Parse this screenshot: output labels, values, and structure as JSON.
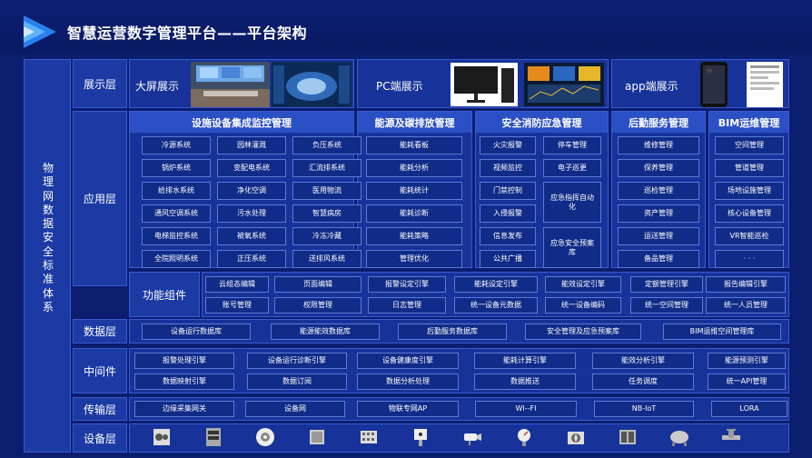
{
  "title": "智慧运营数字管理平台——平台架构",
  "sidebar": "物理网数据安全标准体系",
  "layers": {
    "display": "展示层",
    "app": "应用层",
    "func": "功能组件",
    "data": "数据层",
    "mid": "中间件",
    "trans": "传输层",
    "device": "设备层"
  },
  "display": {
    "big": "大屏展示",
    "pc": "PC端展示",
    "app": "app端展示"
  },
  "heads": [
    "设施设备集成监控管理",
    "能源及碳排放管理",
    "安全消防应急管理",
    "后勤服务管理",
    "BIM运维管理"
  ],
  "facility": [
    "冷源系统",
    "园林灌溉",
    "负压系统",
    "锅炉系统",
    "变配电系统",
    "汇流排系统",
    "给排水系统",
    "净化空调",
    "医用物流",
    "通风空调系统",
    "污水处理",
    "智慧病房",
    "电梯监控系统",
    "被氧系统",
    "冷冻冷藏",
    "全院照明系统",
    "正压系统",
    "送排风系统"
  ],
  "energy": [
    "能耗看板",
    "能耗分析",
    "能耗统计",
    "能耗诊断",
    "能耗策略",
    "管理优化"
  ],
  "safety": [
    "火灾报警",
    "停车管理",
    "视频监控",
    "电子巡更",
    "门禁控制",
    "入侵报警",
    "信息发布",
    "公共广播"
  ],
  "safety_big": [
    "应急指挥自动化",
    "应急安全预案库"
  ],
  "logistics": [
    "维修管理",
    "保养管理",
    "巡检管理",
    "资产管理",
    "运送管理",
    "备品管理"
  ],
  "bim": [
    "空间管理",
    "管道管理",
    "场地设施管理",
    "核心设备管理",
    "VR智能巡检",
    "· · ·"
  ],
  "func": [
    "云组态编辑",
    "页面编辑",
    "报警设定引擎",
    "能耗设定引擎",
    "能效设定引擎",
    "定额管理引擎",
    "报告编辑引擎",
    "账号管理",
    "权限管理",
    "日志管理",
    "统一设备元数据",
    "统一设备编码",
    "统一空间管理",
    "统一人员管理"
  ],
  "data": [
    "设备运行数据库",
    "能源能效数据库",
    "后勤服务数据库",
    "安全管理及应急预案库",
    "BIM运维空间管理库"
  ],
  "mid": [
    "报警处理引擎",
    "设备运行诊断引擎",
    "设备健康度引擎",
    "能耗计算引擎",
    "能效分析引擎",
    "能源预测引擎",
    "数据映射引擎",
    "数据订阅",
    "数据分析处理",
    "数据推送",
    "任务调度",
    "统一API管理"
  ],
  "trans": [
    "边缘采集网关",
    "设备网",
    "物联专网AP",
    "WI--FI",
    "NB-IoT",
    "LORA"
  ],
  "devices": [
    "chiller-icon",
    "cabinet-icon",
    "fan-icon",
    "storage-icon",
    "meter-icon",
    "sensor-icon",
    "camera-icon",
    "gauge-icon",
    "pump-icon",
    "boiler-icon",
    "tank-icon",
    "valve-icon"
  ]
}
